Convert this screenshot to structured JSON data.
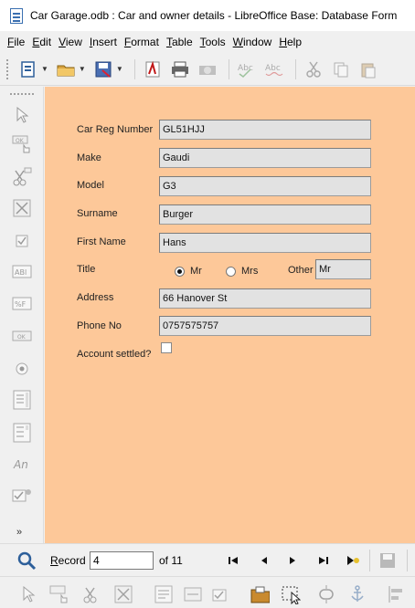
{
  "window": {
    "title": "Car Garage.odb : Car and owner details - LibreOffice Base: Database Form"
  },
  "menu": [
    {
      "mnemonic": "F",
      "rest": "ile"
    },
    {
      "mnemonic": "E",
      "rest": "dit"
    },
    {
      "mnemonic": "V",
      "rest": "iew"
    },
    {
      "mnemonic": "I",
      "rest": "nsert"
    },
    {
      "mnemonic": "F",
      "rest": "ormat"
    },
    {
      "mnemonic": "T",
      "rest": "able"
    },
    {
      "mnemonic": "T",
      "rest": "ools"
    },
    {
      "mnemonic": "W",
      "rest": "indow"
    },
    {
      "mnemonic": "H",
      "rest": "elp"
    }
  ],
  "form": {
    "car_reg": {
      "label": "Car Reg Number",
      "value": "GL51HJJ"
    },
    "make": {
      "label": "Make",
      "value": "Gaudi"
    },
    "model": {
      "label": "Model",
      "value": "G3"
    },
    "surname": {
      "label": "Surname",
      "value": "Burger"
    },
    "first_name": {
      "label": "First Name",
      "value": "Hans"
    },
    "title": {
      "label": "Title",
      "options": [
        "Mr",
        "Mrs"
      ],
      "selected": "Mr",
      "other_label": "Other",
      "other_value": "Mr"
    },
    "address": {
      "label": "Address",
      "value": "66 Hanover St"
    },
    "phone": {
      "label": "Phone No",
      "value": "0757575757"
    },
    "account_settled": {
      "label": "Account settled?",
      "checked": false
    }
  },
  "navigation": {
    "record_mnemonic": "R",
    "record_rest": "ecord",
    "record_value": "4",
    "of_text": "of  11"
  },
  "colors": {
    "form_background": "#fdc899",
    "field_background": "#e2e2e2"
  },
  "left_toolbar_icons": [
    "select-icon",
    "push-button-icon",
    "form-design-icon",
    "design-mode-icon",
    "checkbox-icon",
    "text-box-icon",
    "formatted-field-icon",
    "button-icon",
    "option-button-icon",
    "list-box-icon",
    "combo-box-icon",
    "label-field-icon",
    "control-wizards-icon"
  ],
  "left_toolbar_text_icons": {
    "text_box": "ABl",
    "formatted": "%F",
    "button": "OK",
    "label": "An",
    "push": "OK"
  }
}
